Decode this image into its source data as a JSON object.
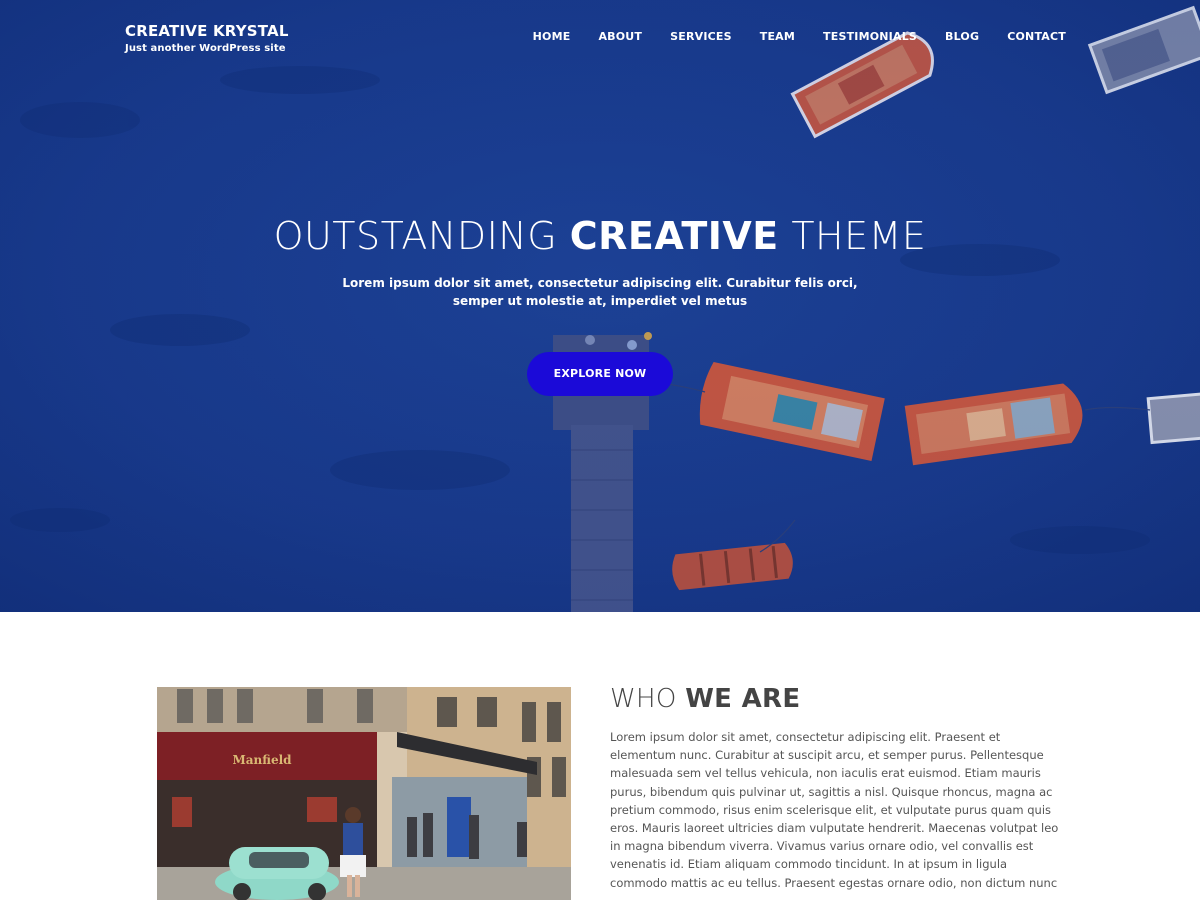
{
  "site": {
    "title": "CREATIVE KRYSTAL",
    "tagline": "Just another WordPress site"
  },
  "nav": {
    "items": [
      "HOME",
      "ABOUT",
      "SERVICES",
      "TEAM",
      "TESTIMONIALS",
      "BLOG",
      "CONTACT"
    ]
  },
  "hero": {
    "title_light_1": "OUTSTANDING ",
    "title_bold": "CREATIVE",
    "title_light_2": " THEME",
    "subtitle": "Lorem ipsum dolor sit amet, consectetur adipiscing elit. Curabitur felis orci, semper ut molestie at, imperdiet vel metus",
    "button_label": "EXPLORE NOW"
  },
  "about": {
    "title_light": "WHO ",
    "title_bold": "WE ARE",
    "body": "Lorem ipsum dolor sit amet, consectetur adipiscing elit. Praesent et elementum nunc. Curabitur at suscipit arcu, et semper purus. Pellentesque malesuada sem vel tellus vehicula, non iaculis erat euismod. Etiam mauris purus, bibendum quis pulvinar ut, sagittis a nisl. Quisque rhoncus, magna ac pretium commodo, risus enim scelerisque elit, et vulputate purus quam quis eros. Mauris laoreet ultricies diam vulputate hendrerit. Maecenas volutpat leo in magna bibendum viverra. Vivamus varius ornare odio, vel convallis est venenatis id. Etiam aliquam commodo tincidunt. In at ipsum in ligula commodo mattis ac eu tellus. Praesent egestas ornare odio, non dictum nunc",
    "storefront_sign": "Manfield"
  },
  "colors": {
    "hero_blue": "#1a3a8c",
    "button": "#1b0ad8",
    "boat_red": "#c8563f",
    "heading_text": "#444444"
  }
}
